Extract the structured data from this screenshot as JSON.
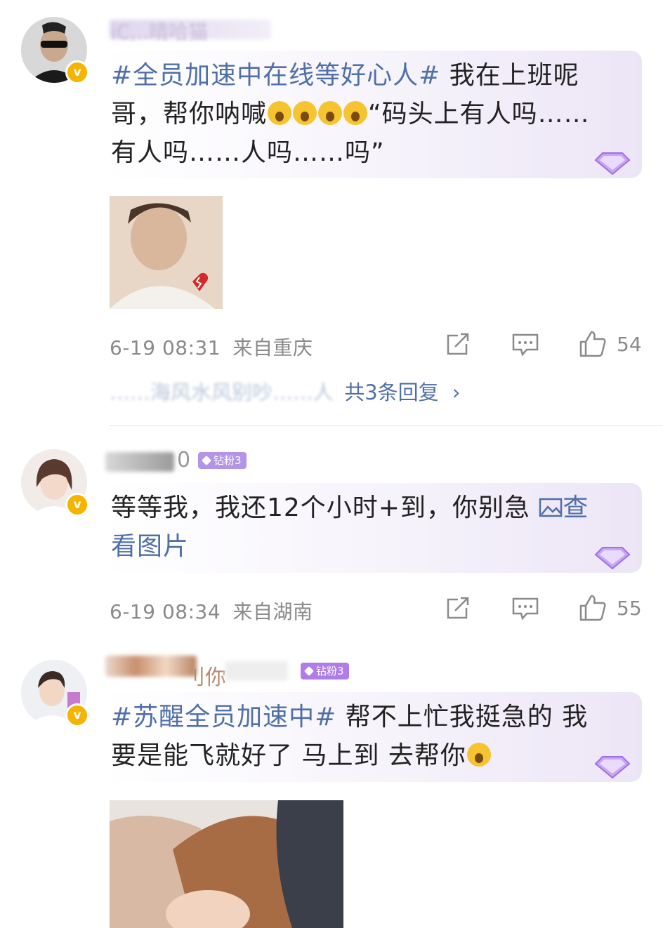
{
  "comments": [
    {
      "username_partial": "iC,..晴哈猫",
      "text_tag": "#全员加速中在线等好心人#",
      "text_body": " 我在上班呢哥，帮你呐喊",
      "text_tail": "“码头上有人吗……有人吗……人吗……吗”",
      "time": "6-19 08:31",
      "location": "来自重庆",
      "likes": "54",
      "replies_preview": "……海风水风别吵……人",
      "replies_link": "共3条回复",
      "replies_chevron": "›"
    },
    {
      "username_partial": "0",
      "badge": "钻粉3",
      "text_body": "等等我，我还12个小时+到，你别急 ",
      "view_image": "查看图片",
      "time": "6-19 08:34",
      "location": "来自湖南",
      "likes": "55"
    },
    {
      "username_partial": "刂你",
      "badge": "钻粉3",
      "text_tag": "#苏醒全员加速中#",
      "text_body": " 帮不上忙我挺急的 我要是能飞就好了 马上到 去帮你"
    }
  ],
  "icons": {
    "verified": "verified-icon",
    "share": "share-icon",
    "comment": "comment-icon",
    "like": "like-icon",
    "gem": "gem-icon",
    "image": "image-icon"
  },
  "colors": {
    "link": "#4f6fa7",
    "badge": "#b394e6",
    "verified": "#f5b400"
  }
}
